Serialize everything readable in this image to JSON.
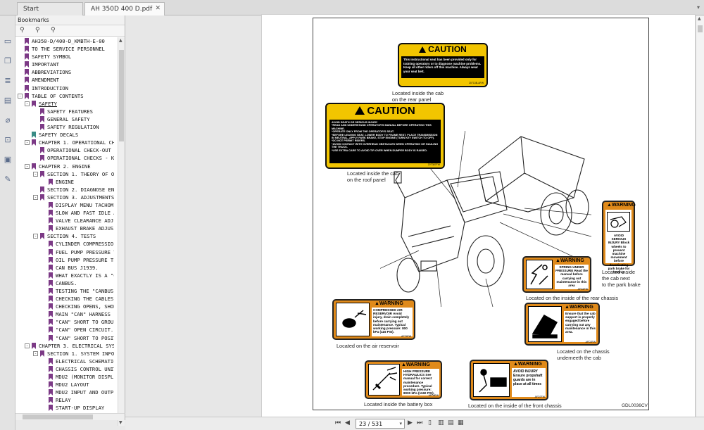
{
  "tabs": [
    {
      "label": "Start"
    },
    {
      "label": "AH 350D 400 D.pdf"
    }
  ],
  "bookmarks": {
    "title": "Bookmarks",
    "items": [
      {
        "label": "AH350-D/400-D_KMBTH-E-00",
        "level": 0,
        "expand": ""
      },
      {
        "label": "TO THE SERVICE PERSONNEL",
        "level": 0,
        "expand": ""
      },
      {
        "label": "SAFETY SYMBOL",
        "level": 0,
        "expand": ""
      },
      {
        "label": "IMPORTANT",
        "level": 0,
        "expand": ""
      },
      {
        "label": "ABBREVIATIONS",
        "level": 0,
        "expand": ""
      },
      {
        "label": "AMENDMENT",
        "level": 0,
        "expand": ""
      },
      {
        "label": "INTRODUCTION",
        "level": 0,
        "expand": ""
      },
      {
        "label": "TABLE OF CONTENTS",
        "level": 0,
        "expand": "-"
      },
      {
        "label": "SAFETY",
        "level": 1,
        "expand": "-",
        "underline": true
      },
      {
        "label": "SAFETY FEATURES",
        "level": 2,
        "expand": ""
      },
      {
        "label": "GENERAL SAFETY",
        "level": 2,
        "expand": ""
      },
      {
        "label": "SAFETY REGULATION",
        "level": 2,
        "expand": ""
      },
      {
        "label": "SAFETY DECALS",
        "level": 1,
        "expand": "",
        "teal": true
      },
      {
        "label": "CHAPTER 1. OPERATIONAL CH",
        "level": 1,
        "expand": "-"
      },
      {
        "label": "OPERATIONAL CHECK-OUT",
        "level": 2,
        "expand": ""
      },
      {
        "label": "OPERATIONAL CHECKS - KE",
        "level": 2,
        "expand": ""
      },
      {
        "label": "CHAPTER 2. ENGINE",
        "level": 1,
        "expand": "-"
      },
      {
        "label": "SECTION 1. THEORY OF OF",
        "level": 2,
        "expand": "-"
      },
      {
        "label": "ENGINE",
        "level": 3,
        "expand": ""
      },
      {
        "label": "SECTION 2. DIAGNOSE ENG",
        "level": 2,
        "expand": ""
      },
      {
        "label": "SECTION 3. ADJUSTMENTS",
        "level": 2,
        "expand": "-"
      },
      {
        "label": "DISPLAY MENU TACHOM",
        "level": 3,
        "expand": ""
      },
      {
        "label": "SLOW AND FAST IDLE A",
        "level": 3,
        "expand": ""
      },
      {
        "label": "VALVE CLEARANCE ADJ",
        "level": 3,
        "expand": ""
      },
      {
        "label": "EXHAUST BRAKE ADJUS",
        "level": 3,
        "expand": ""
      },
      {
        "label": "SECTION 4. TESTS",
        "level": 2,
        "expand": "-"
      },
      {
        "label": "CYLINDER COMPRESSIO",
        "level": 3,
        "expand": ""
      },
      {
        "label": "FUEL PUMP PRESSURE T",
        "level": 3,
        "expand": ""
      },
      {
        "label": "OIL PUMP PRESSURE TE",
        "level": 3,
        "expand": ""
      },
      {
        "label": "CAN BUS J1939.",
        "level": 3,
        "expand": ""
      },
      {
        "label": "WHAT EXACTLY IS A \"C",
        "level": 3,
        "expand": ""
      },
      {
        "label": "CANBUS.",
        "level": 3,
        "expand": ""
      },
      {
        "label": "TESTING THE \"CANBUS\"",
        "level": 3,
        "expand": ""
      },
      {
        "label": "CHECKING THE CABLES",
        "level": 3,
        "expand": ""
      },
      {
        "label": "CHECKING OPENS, SHOR",
        "level": 3,
        "expand": ""
      },
      {
        "label": "MAIN \"CAN\" HARNESS",
        "level": 3,
        "expand": ""
      },
      {
        "label": "\"CAN\" SHORT TO GROU",
        "level": 3,
        "expand": ""
      },
      {
        "label": "\"CAN\" OPEN CIRCUIT.",
        "level": 3,
        "expand": ""
      },
      {
        "label": "\"CAN\" SHORT TO POSIT",
        "level": 3,
        "expand": ""
      },
      {
        "label": "CHAPTER 3. ELECTRICAL SYST",
        "level": 1,
        "expand": "-"
      },
      {
        "label": "SECTION 1. SYSTEM INFOR",
        "level": 2,
        "expand": "-"
      },
      {
        "label": "ELECTRICAL SCHEMATIC",
        "level": 3,
        "expand": ""
      },
      {
        "label": "CHASSIS CONTROL UNIT",
        "level": 3,
        "expand": ""
      },
      {
        "label": "MDU2 (MONITOR DISPL",
        "level": 3,
        "expand": ""
      },
      {
        "label": "MDU2 LAYOUT",
        "level": 3,
        "expand": ""
      },
      {
        "label": "MDU2 INPUT AND OUTP",
        "level": 3,
        "expand": ""
      },
      {
        "label": "RELAY",
        "level": 3,
        "expand": ""
      },
      {
        "label": "START-UP DISPLAY",
        "level": 3,
        "expand": ""
      }
    ]
  },
  "decals": {
    "caution1": {
      "header": "CAUTION",
      "text": "This instructional seat has been provided only for training operators or to diagnose machine problems. Keep all other riders off this machine. Always wear your seat belt.",
      "code": "20713B-AFW",
      "caption": "Located inside the cab\non the rear panel"
    },
    "caution2": {
      "header": "CAUTION",
      "text": "AVOID DEATH OR SERIOUS INJURY\n*READ AND UNDERSTAND OPERATOR'S MANUAL BEFORE OPERATING THIS MACHINE.\n*OPERATE ONLY FROM THE OPERATOR'S SEAT.\n*BEFORE LEAVING SEAT, LOWER BODY TO FRAME REST, PLACE TRANSMISSION IN NEUTRAL, APPLY PARK BRAKE, STOP ENGINE (TURN KEY SWITCH TO OFF).\n*DO NOT PERMIT RIDERS.\n*AVOID CONTACT WITH OVERHEAD OBSTACLES WHEN OPERATING OR HAULING THE TRUCK.\n*USE EXTRA CARE TO AVOID TIP-OVER WHEN DUMPER BODY IS RAISED.",
      "code": "20T387FW",
      "caption": "Located inside the cab\non the roof panel"
    },
    "park_brake": {
      "header": "WARNING",
      "text": "AVOID SERIOUS INJURY Block wheels to prevent machine movement before deactivating park brake for towing.",
      "caption": "Located inside\nthe cab next\nto the park brake"
    },
    "spring": {
      "header": "WARNING",
      "text": "SPRING UNDER PRESSURE Read the manual before carrying out maintenance in this area",
      "code": "AFD4FW",
      "caption": "Located on the inside of the rear chassis"
    },
    "air": {
      "header": "WARNING",
      "text": "COMPRESSED AIR RESERVOIR Avoid injury, drain completely before carrying out maintenance. Typical working pressure: 800 kPa (116 PSI).",
      "code": "AFT4FW",
      "caption": "Located on the air reservoir"
    },
    "cab_support": {
      "header": "WARNING",
      "text": "Ensure that the cab support is properly engaged before carrying out any maintenance in this area.",
      "code": "AFD2FW",
      "caption": "Located on the chassis\nunderneeth the cab"
    },
    "hydraulics": {
      "header": "WARNING",
      "text": "HIGH PRESSURE HYDRAULICS See manual for correct maintenance procedure. Typical working pressure: 8000 kPa (1160 PSI).",
      "code": "AFD8FW",
      "caption": "Located inside the battery box"
    },
    "propshaft": {
      "header": "WARNING",
      "text": "AVOID INJURY Ensure propshaft guards are in place at all times",
      "code": "AFD7FW",
      "caption": "Located on the inside of the front chassis"
    },
    "figure_code": "GDL0036CV"
  },
  "navigation": {
    "page_display": "23 / 531"
  }
}
